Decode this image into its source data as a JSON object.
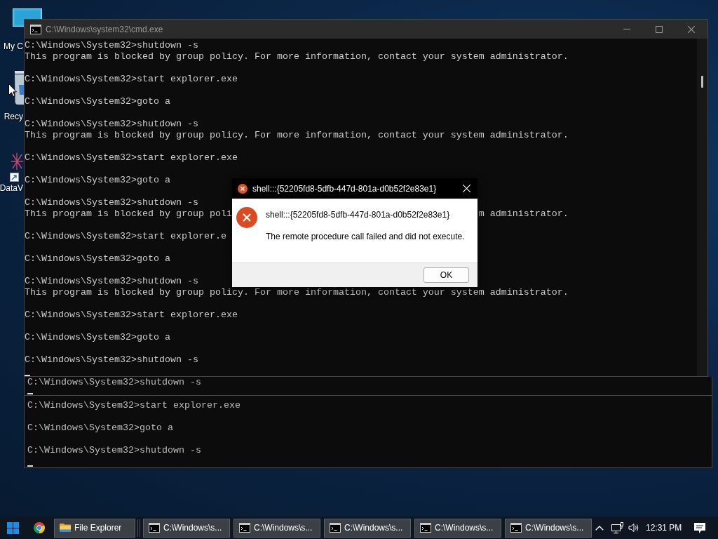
{
  "desktop": {
    "icons": [
      {
        "kind": "computer",
        "label": "My C"
      },
      {
        "kind": "recycle-bin",
        "label": "Recy"
      },
      {
        "kind": "shortcut",
        "label": "DataV"
      }
    ]
  },
  "back_console": {
    "panes": [
      {
        "entries": [
          {
            "line": "C:\\Windows\\System32>shutdown -s"
          }
        ]
      },
      {
        "entries": [
          {
            "line": "C:\\Windows\\System32>start explorer.exe"
          },
          {
            "line": "C:\\Windows\\System32>goto a"
          },
          {
            "line": "C:\\Windows\\System32>shutdown -s"
          }
        ]
      }
    ]
  },
  "console_window": {
    "title": "C:\\Windows\\system32\\cmd.exe",
    "entries": [
      {
        "line": "C:\\Windows\\System32>shutdown -s",
        "output": [
          {
            "text": "This program is blocked by group policy. For more information, contact your system administrator."
          }
        ]
      },
      {
        "line": "C:\\Windows\\System32>start explorer.exe"
      },
      {
        "line": "C:\\Windows\\System32>goto a"
      },
      {
        "line": "C:\\Windows\\System32>shutdown -s",
        "output": [
          {
            "text": "This program is blocked by group policy. For more information, contact your system administrator."
          }
        ]
      },
      {
        "line": "C:\\Windows\\System32>start explorer.exe"
      },
      {
        "line": "C:\\Windows\\System32>goto a"
      },
      {
        "line": "C:\\Windows\\System32>shutdown -s",
        "output": [
          {
            "text": "This program is blocked by group poli",
            "tail": "m administrator."
          }
        ]
      },
      {
        "line": "C:\\Windows\\System32>start explorer.e"
      },
      {
        "line": "C:\\Windows\\System32>goto a"
      },
      {
        "line": "C:\\Windows\\System32>shutdown -s",
        "output": [
          {
            "text": "This program is blocked by group policy. For more information, contact your system administrator."
          }
        ]
      },
      {
        "line": "C:\\Windows\\System32>start explorer.exe"
      },
      {
        "line": "C:\\Windows\\System32>goto a"
      },
      {
        "line": "C:\\Windows\\System32>shutdown -s"
      }
    ]
  },
  "dialog": {
    "title": "shell:::{52205fd8-5dfb-447d-801a-d0b52f2e83e1}",
    "heading": "shell:::{52205fd8-5dfb-447d-801a-d0b52f2e83e1}",
    "message": "The remote procedure call failed and did not execute.",
    "button": "OK"
  },
  "taskbar": {
    "buttons": [
      {
        "kind": "folder",
        "label": "File Explorer"
      },
      {
        "kind": "console",
        "label": "C:\\Windows\\s..."
      },
      {
        "kind": "console",
        "label": "C:\\Windows\\s..."
      },
      {
        "kind": "console",
        "label": "C:\\Windows\\s..."
      },
      {
        "kind": "console",
        "label": "C:\\Windows\\s..."
      },
      {
        "kind": "console",
        "label": "C:\\Windows\\s..."
      }
    ],
    "clock": "12:31 PM"
  }
}
